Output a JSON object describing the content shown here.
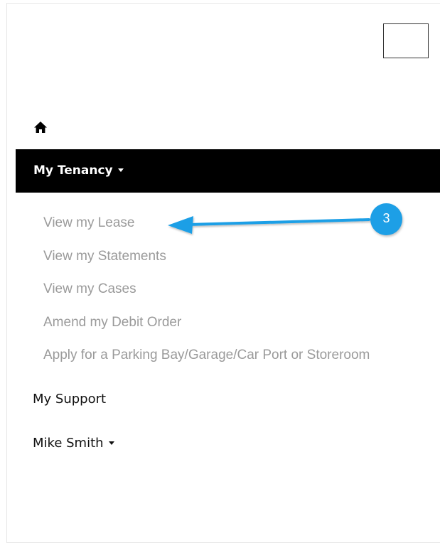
{
  "nav": {
    "home_icon": "home-icon",
    "toggle_icon": "menu-toggle",
    "my_tenancy": {
      "label": "My Tenancy",
      "items": [
        {
          "label": "View my Lease"
        },
        {
          "label": "View my Statements"
        },
        {
          "label": "View my Cases"
        },
        {
          "label": "Amend my Debit Order"
        },
        {
          "label": "Apply for a Parking Bay/Garage/Car Port or Storeroom"
        }
      ]
    },
    "my_support": {
      "label": "My Support"
    },
    "user_menu": {
      "label": "Mike Smith"
    }
  },
  "annotation": {
    "step_number": "3",
    "accent_color": "#1d9fe6"
  },
  "colors": {
    "active_bar": "#000000",
    "submenu_text": "#9a9a9a",
    "nav_text": "#111111"
  }
}
